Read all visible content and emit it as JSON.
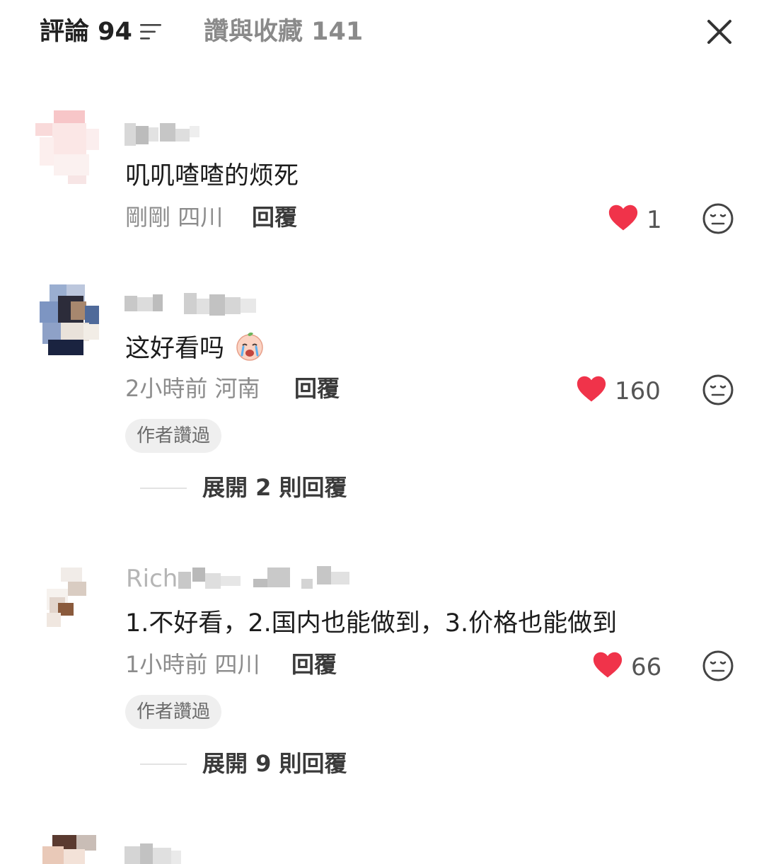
{
  "header": {
    "comments_tab": "評論 94",
    "likes_tab": "讚與收藏 141"
  },
  "comments": [
    {
      "username_partial": "",
      "text": "叽叽喳喳的烦死",
      "time": "剛剛",
      "location": "四川",
      "reply_label": "回覆",
      "likes": "1"
    },
    {
      "username_partial": "",
      "text": "这好看吗",
      "emoji": "crying-face-emoji",
      "time": "2小時前",
      "location": "河南",
      "reply_label": "回覆",
      "likes": "160",
      "badge": "作者讚過",
      "expand": "展開 2 則回覆"
    },
    {
      "username_partial": "Rich",
      "text": "1.不好看，2.国内也能做到，3.价格也能做到",
      "time": "1小時前",
      "location": "四川",
      "reply_label": "回覆",
      "likes": "66",
      "badge": "作者讚過",
      "expand": "展開 9 則回覆"
    },
    {
      "username_partial": ""
    }
  ],
  "colors": {
    "heart": "#f0334a",
    "muted": "#8c8c8c",
    "badge_bg": "#efefef"
  }
}
